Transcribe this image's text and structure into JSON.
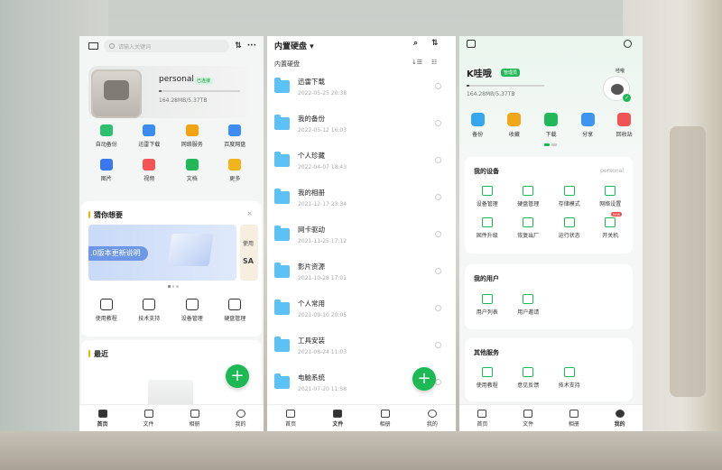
{
  "colors": {
    "accent": "#1db954",
    "folder": "#5cc1f4"
  },
  "panel1": {
    "search_placeholder": "请输入关键词",
    "device_name": "personal",
    "device_badge": "已连接",
    "storage": "164.28MB/5.37TB",
    "storage_used_percent": 3,
    "apps": [
      {
        "label": "自动备份",
        "icon": "backup-icon",
        "color": "#2fbf71"
      },
      {
        "label": "迅雷下载",
        "icon": "thunder-icon",
        "color": "#3a8cf0"
      },
      {
        "label": "网络服务",
        "icon": "network-service-icon",
        "color": "#f3a312"
      },
      {
        "label": "百度网盘",
        "icon": "baidu-cloud-icon",
        "color": "#3d8df5"
      },
      {
        "label": "图片",
        "icon": "image-icon",
        "color": "#3a78f0"
      },
      {
        "label": "视频",
        "icon": "video-icon",
        "color": "#f25555"
      },
      {
        "label": "文档",
        "icon": "document-icon",
        "color": "#22b85a"
      },
      {
        "label": "更多",
        "icon": "more-apps-icon",
        "color": "#f2b41a"
      }
    ],
    "guess_title": "猜你想要",
    "close": "×",
    "banner_text": ".0版本更新说明",
    "banner2_line1": "使用",
    "banner2_line2": "SA",
    "guess_items": [
      {
        "label": "使用教程",
        "icon": "tutorial-icon"
      },
      {
        "label": "技术支持",
        "icon": "support-icon"
      },
      {
        "label": "设备管理",
        "icon": "device-manage-icon"
      },
      {
        "label": "硬盘管理",
        "icon": "disk-manage-icon"
      }
    ],
    "recent_title": "最近",
    "fab": "+",
    "tabs": [
      {
        "label": "首页",
        "icon": "home-icon",
        "active": true
      },
      {
        "label": "文件",
        "icon": "folder-icon",
        "active": false
      },
      {
        "label": "相册",
        "icon": "album-icon",
        "active": false
      },
      {
        "label": "我的",
        "icon": "profile-icon",
        "active": false
      }
    ]
  },
  "panel2": {
    "title": "内置硬盘 ▾",
    "search_icon": "⌕",
    "sort_icon": "⇅",
    "subpath": "内置硬盘",
    "sub_sort_icon": "↓☰",
    "sub_view_icon": "☷",
    "files": [
      {
        "name": "迅雷下载",
        "date": "2022-05-25 20:38"
      },
      {
        "name": "我的备份",
        "date": "2022-05-12 16:03"
      },
      {
        "name": "个人珍藏",
        "date": "2022-04-07 18:43"
      },
      {
        "name": "我的相册",
        "date": "2021-12-17 23:34"
      },
      {
        "name": "网卡驱动",
        "date": "2021-11-25 17:12"
      },
      {
        "name": "影片资源",
        "date": "2021-10-28 17:01"
      },
      {
        "name": "个人常用",
        "date": "2021-09-10 20:05"
      },
      {
        "name": "工具安装",
        "date": "2021-08-24 11:03"
      },
      {
        "name": "电脑系统",
        "date": "2021-07-20 11:58"
      }
    ],
    "fab": "+",
    "tabs": [
      {
        "label": "首页",
        "icon": "home-icon",
        "active": false
      },
      {
        "label": "文件",
        "icon": "folder-icon",
        "active": true
      },
      {
        "label": "相册",
        "icon": "album-icon",
        "active": false
      },
      {
        "label": "我的",
        "icon": "profile-icon",
        "active": false
      }
    ]
  },
  "panel3": {
    "username": "K哇哦",
    "role": "管理员",
    "storage": "164.28MB/5.37TB",
    "storage_used_percent": 3,
    "avatar_name": "哇哦",
    "quick": [
      {
        "label": "备份",
        "icon": "backup-icon",
        "color": "#37a6f0"
      },
      {
        "label": "收藏",
        "icon": "star-icon",
        "color": "#f2a71a"
      },
      {
        "label": "下载",
        "icon": "download-icon",
        "color": "#22b85a"
      },
      {
        "label": "分享",
        "icon": "share-icon",
        "color": "#3d94f2"
      },
      {
        "label": "回收站",
        "icon": "trash-icon",
        "color": "#f05454"
      }
    ],
    "device_section": {
      "title": "我的设备",
      "right": "personal",
      "items": [
        {
          "label": "设备管理",
          "icon": "device-manage-icon"
        },
        {
          "label": "硬盘管理",
          "icon": "disk-manage-icon"
        },
        {
          "label": "存储模式",
          "icon": "storage-mode-icon"
        },
        {
          "label": "网络设置",
          "icon": "network-settings-icon"
        },
        {
          "label": "固件升级",
          "icon": "firmware-upgrade-icon"
        },
        {
          "label": "恢复出厂",
          "icon": "factory-reset-icon"
        },
        {
          "label": "运行状态",
          "icon": "run-status-icon"
        },
        {
          "label": "开关机",
          "icon": "power-icon",
          "tag": "new"
        }
      ]
    },
    "user_section": {
      "title": "我的用户",
      "items": [
        {
          "label": "用户列表",
          "icon": "user-list-icon"
        },
        {
          "label": "用户邀请",
          "icon": "user-invite-icon"
        }
      ]
    },
    "other_section": {
      "title": "其他服务",
      "items": [
        {
          "label": "使用教程",
          "icon": "tutorial-icon"
        },
        {
          "label": "意见反馈",
          "icon": "feedback-icon"
        },
        {
          "label": "技术支持",
          "icon": "support-icon"
        }
      ]
    },
    "tabs": [
      {
        "label": "首页",
        "icon": "home-icon",
        "active": false
      },
      {
        "label": "文件",
        "icon": "folder-icon",
        "active": false
      },
      {
        "label": "相册",
        "icon": "album-icon",
        "active": false
      },
      {
        "label": "我的",
        "icon": "profile-icon",
        "active": true
      }
    ]
  }
}
